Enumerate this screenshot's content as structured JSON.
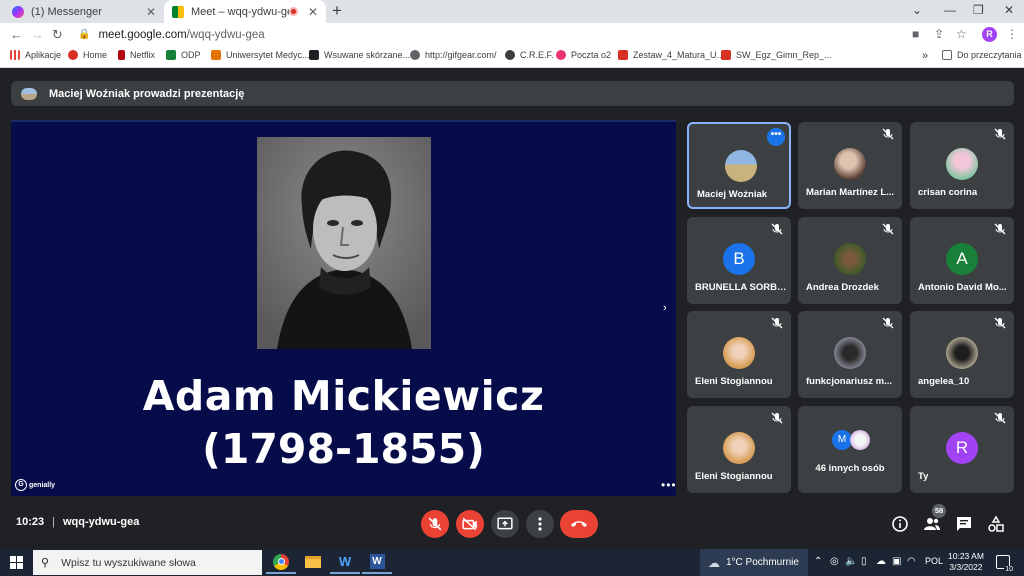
{
  "browser": {
    "tabs": [
      {
        "title": "(1) Messenger",
        "close": "✕"
      },
      {
        "title": "Meet – wqq-ydwu-gea",
        "close": "✕"
      }
    ],
    "new_tab": "+",
    "window_controls": [
      "⌄",
      "—",
      "❐",
      "✕"
    ],
    "url_host": "meet.google.com",
    "url_path": "/wqq-ydwu-gea",
    "profile_initial": "R",
    "bookmarks": [
      {
        "label": "Aplikacje",
        "color": "#ea4335"
      },
      {
        "label": "Home",
        "color": "#d93025"
      },
      {
        "label": "Netflix",
        "color": "#b20710"
      },
      {
        "label": "ODP",
        "color": "#188038"
      },
      {
        "label": "Uniwersytet Medyc...",
        "color": "#e37400"
      },
      {
        "label": "Wsuwane skórzane...",
        "color": "#202124"
      },
      {
        "label": "http://gifgear.com/",
        "color": "#5f6368"
      },
      {
        "label": "C.R.E.F.",
        "color": "#3c4043"
      },
      {
        "label": "Poczta o2",
        "color": "#e8336d"
      },
      {
        "label": "Zestaw_4_Matura_U...",
        "color": "#d93025"
      },
      {
        "label": "SW_Egz_Gimn_Rep_...",
        "color": "#d93025"
      }
    ],
    "bookmarks_more": "»",
    "reading_list": "Do przeczytania"
  },
  "meet": {
    "banner": "Maciej Woźniak prowadzi prezentację",
    "slide": {
      "name": "Adam Mickiewicz",
      "years": "(1798-1855)",
      "brand": "genially",
      "next": "›",
      "more": "•••"
    },
    "participants": [
      {
        "name": "Maciej Woźniak",
        "active": true
      },
      {
        "name": "Marian Martínez L..."
      },
      {
        "name": "crisan corina"
      },
      {
        "name": "BRUNELLA SORBE...",
        "initial": "B",
        "color": "#1a73e8"
      },
      {
        "name": "Andrea Drozdek"
      },
      {
        "name": "Antonio David Mo...",
        "initial": "A",
        "color": "#188038"
      },
      {
        "name": "Eleni Stogiannou"
      },
      {
        "name": "funkcjonariusz m..."
      },
      {
        "name": "angelea_10"
      },
      {
        "name": "Eleni Stogiannou"
      },
      {
        "name": "46 innych osób",
        "initial": "M",
        "color": "#1a73e8"
      },
      {
        "name": "Ty",
        "initial": "R",
        "color": "#a142f4"
      }
    ],
    "more_dots": "•••",
    "time": "10:23",
    "separator": "|",
    "meeting_code": "wqq-ydwu-gea",
    "participant_count": "58"
  },
  "taskbar": {
    "search_placeholder": "Wpisz tu wyszukiwane słowa",
    "weather": "1°C  Pochmurnie",
    "language": "POL",
    "time": "10:23 AM",
    "date": "3/3/2022",
    "notifications": "10"
  }
}
